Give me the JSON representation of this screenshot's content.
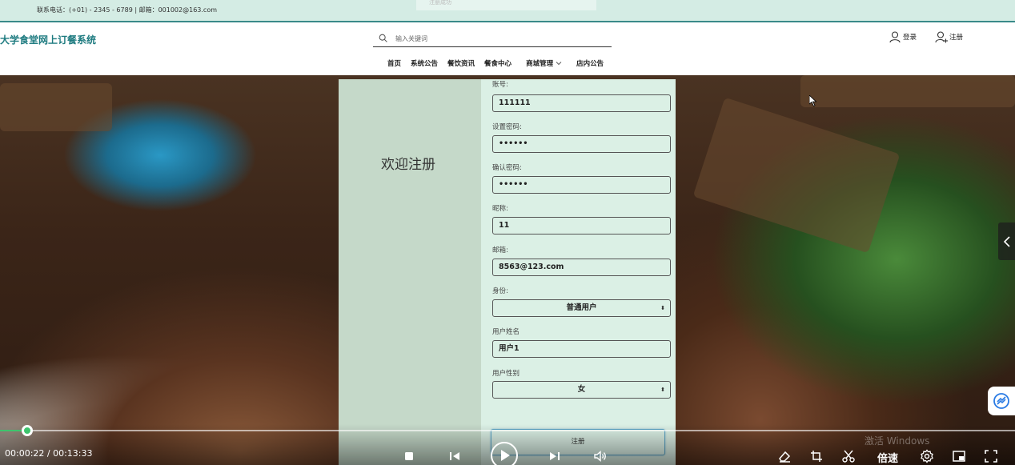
{
  "topbar": {
    "contact": "联系电话：(+01) - 2345 - 6789 | 邮箱：001002@163.com",
    "ghost_text": "注册成功"
  },
  "header": {
    "site_title": "大学食堂网上订餐系统",
    "search_placeholder": "输入关键词",
    "login_label": "登录",
    "register_label": "注册"
  },
  "nav": {
    "items": [
      {
        "label": "首页"
      },
      {
        "label": "系统公告"
      },
      {
        "label": "餐饮资讯"
      },
      {
        "label": "餐食中心"
      },
      {
        "label": "商城管理"
      },
      {
        "label": "店内公告"
      }
    ]
  },
  "register": {
    "welcome": "欢迎注册",
    "fields": [
      {
        "label": "账号:",
        "value": "111111"
      },
      {
        "label": "设置密码:",
        "value": "••••••"
      },
      {
        "label": "确认密码:",
        "value": "••••••"
      },
      {
        "label": "昵称:",
        "value": "11"
      },
      {
        "label": "邮箱:",
        "value": "8563@123.com"
      },
      {
        "label": "身份:",
        "value": "普通用户"
      },
      {
        "label": "用户姓名",
        "value": "用户1"
      },
      {
        "label": "用户性别",
        "value": "女"
      }
    ],
    "submit_label": "注册"
  },
  "player": {
    "time": "00:00:22 / 00:13:33",
    "progress": 0.027,
    "speed_label": "倍速",
    "accent_color": "#3ec46d"
  },
  "watermark": "激活 Windows"
}
